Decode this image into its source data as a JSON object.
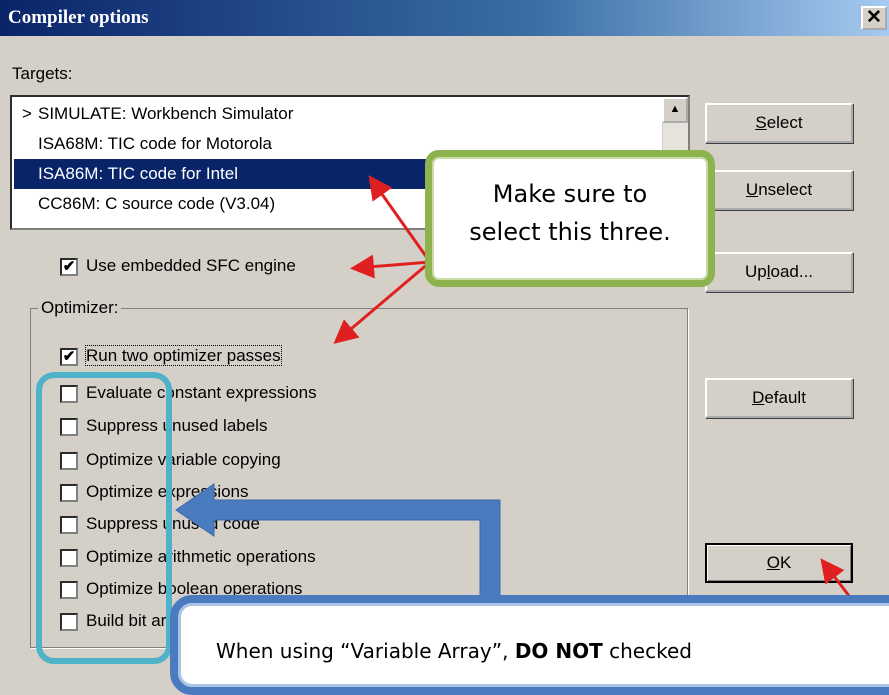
{
  "window": {
    "title": "Compiler options",
    "close_label": "✕"
  },
  "targets": {
    "label": "Targets:",
    "items": [
      {
        "marker": ">",
        "text": "SIMULATE: Workbench Simulator"
      },
      {
        "marker": "",
        "text": "ISA68M: TIC code for Motorola"
      },
      {
        "marker": "",
        "text": "ISA86M: TIC code for Intel"
      },
      {
        "marker": "",
        "text": "CC86M: C source code (V3.04)"
      }
    ],
    "selected_index": 2
  },
  "use_embedded_sfc": {
    "label": "Use embedded SFC engine",
    "checked": true
  },
  "optimizer": {
    "label": "Optimizer:",
    "options": [
      {
        "label": "Run two optimizer passes",
        "checked": true
      },
      {
        "label": "Evaluate constant expressions",
        "checked": false
      },
      {
        "label": "Suppress unused labels",
        "checked": false
      },
      {
        "label": "Optimize variable copying",
        "checked": false
      },
      {
        "label": "Optimize expressions",
        "checked": false
      },
      {
        "label": "Suppress unused code",
        "checked": false
      },
      {
        "label": "Optimize arithmetic operations",
        "checked": false
      },
      {
        "label": "Optimize boolean operations",
        "checked": false
      },
      {
        "label": "Build bit arrays",
        "checked": false
      }
    ]
  },
  "buttons": {
    "select": {
      "accel": "S",
      "rest": "elect"
    },
    "unselect": {
      "accel": "U",
      "rest": "nselect"
    },
    "upload": {
      "pre": "Up",
      "accel": "l",
      "rest": "oad..."
    },
    "default": {
      "accel": "D",
      "rest": "efault"
    },
    "ok": {
      "accel": "O",
      "rest": "K"
    }
  },
  "annotations": {
    "callout_line1": "Make sure to",
    "callout_line2": "select this three.",
    "note_pre": "When using “Variable Array”, ",
    "note_bold": "DO NOT",
    "note_post": " checked",
    "arrow_color": "#e02020",
    "blue_arrow_color": "#4a7bbf",
    "highlight_color": "#4eb3c8",
    "callout_border_color": "#8db34f"
  }
}
